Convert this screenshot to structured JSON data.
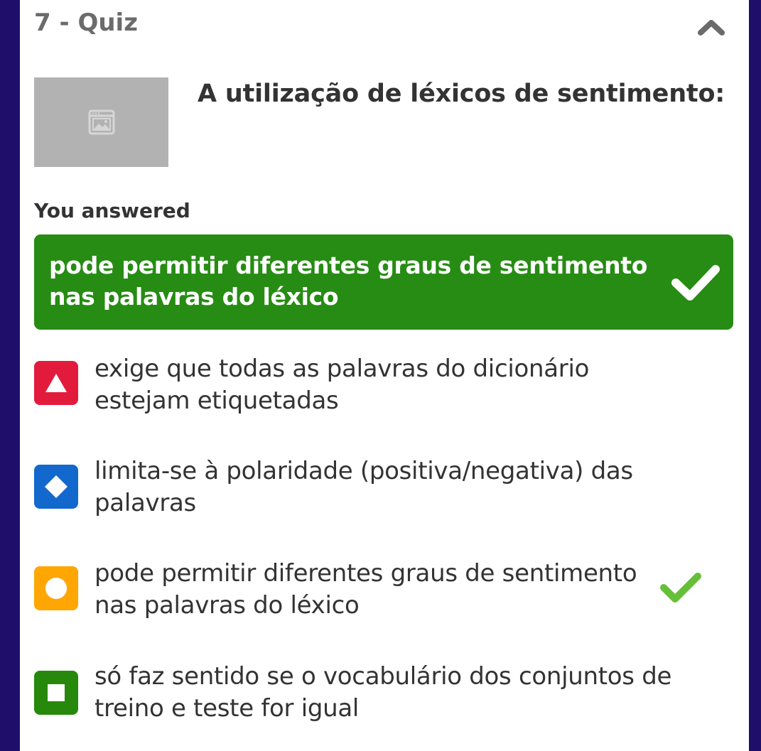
{
  "header": {
    "title": "7 - Quiz",
    "collapse_icon": "chevron-up-icon"
  },
  "question": {
    "image_icon": "image-placeholder-icon",
    "text": "A utilização de léxicos de sentimento:"
  },
  "answered": {
    "label": "You answered",
    "answer": "pode permitir diferentes graus de sentimento nas palavras do léxico",
    "correct": true,
    "color": "#268c13"
  },
  "options": [
    {
      "shape": "triangle-icon",
      "color": "#e21b3c",
      "text": "exige que todas as palavras do dicionário estejam etiquetadas",
      "correct": false
    },
    {
      "shape": "diamond-icon",
      "color": "#1368ce",
      "text": "limita-se à polaridade (positiva/negativa) das palavras",
      "correct": false
    },
    {
      "shape": "circle-icon",
      "color": "#ffa602",
      "text": "pode permitir diferentes graus de sentimento nas palavras do léxico",
      "correct": true
    },
    {
      "shape": "square-icon",
      "color": "#26890c",
      "text": "só faz sentido se o vocabulário dos conjuntos de treino e teste for igual",
      "correct": false
    }
  ],
  "colors": {
    "background": "#1f0f6b",
    "correct_check": "#66bf39"
  }
}
